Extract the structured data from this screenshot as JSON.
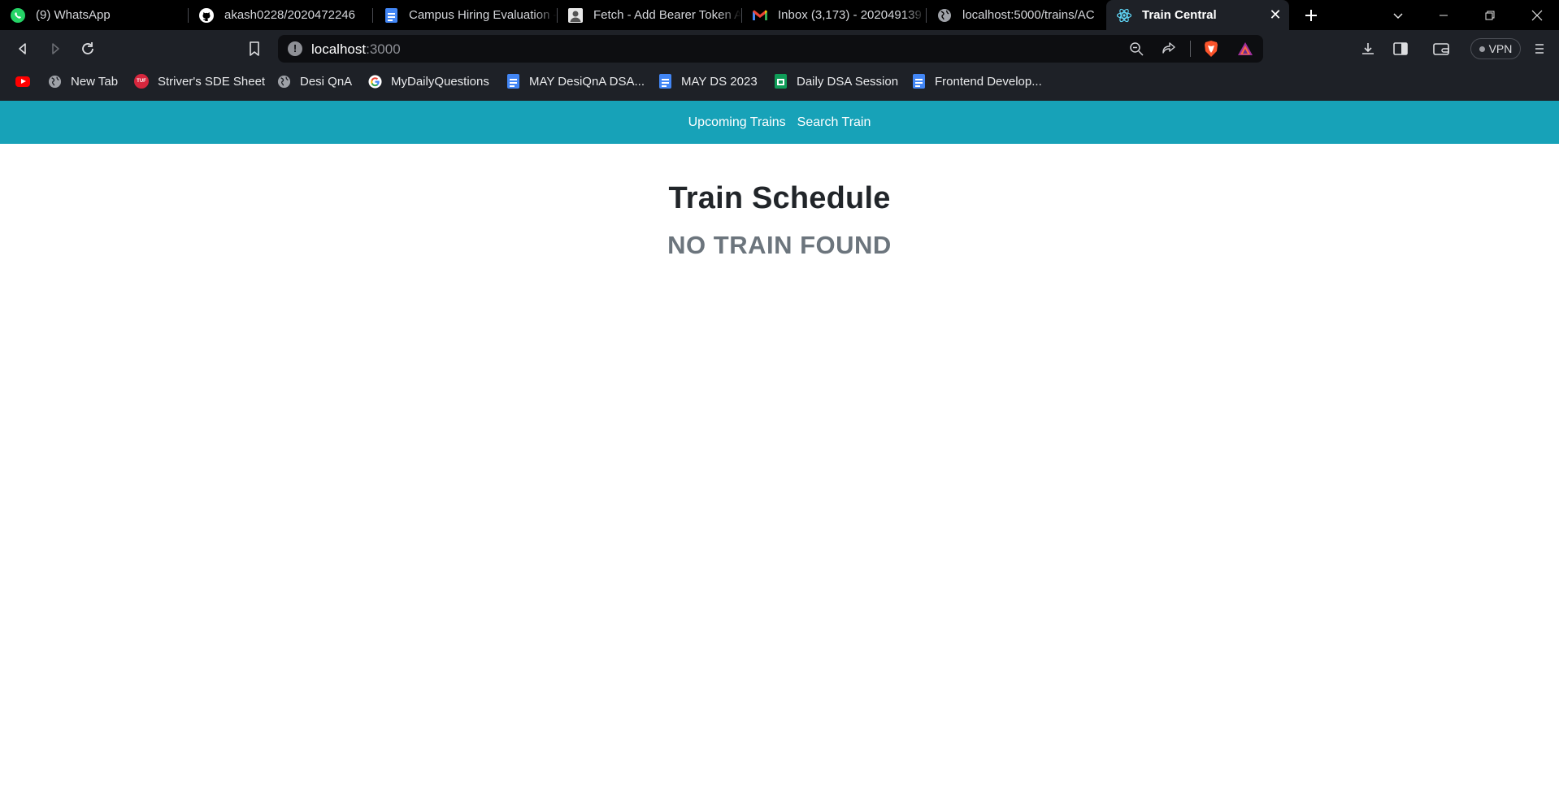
{
  "browser": {
    "tabs": [
      {
        "title": "(9) WhatsApp",
        "icon": "whatsapp-icon",
        "active": false
      },
      {
        "title": "akash0228/2020472246",
        "icon": "github-icon",
        "active": false
      },
      {
        "title": "Campus Hiring Evaluation -",
        "icon": "google-docs-icon",
        "active": false
      },
      {
        "title": "Fetch - Add Bearer Token A",
        "icon": "avatar-favicon-icon",
        "active": false
      },
      {
        "title": "Inbox (3,173) - 202049139",
        "icon": "gmail-icon",
        "active": false
      },
      {
        "title": "localhost:5000/trains/AC",
        "icon": "globe-icon",
        "active": false
      },
      {
        "title": "Train Central",
        "icon": "react-icon",
        "active": true
      }
    ],
    "address": {
      "host": "localhost",
      "port": ":3000"
    },
    "vpn_label": "VPN",
    "bookmarks": [
      {
        "label": "",
        "icon": "youtube-icon"
      },
      {
        "label": "New Tab",
        "icon": "globe-icon"
      },
      {
        "label": "Striver's SDE Sheet",
        "icon": "tuf-icon"
      },
      {
        "label": "Desi QnA",
        "icon": "globe-icon"
      },
      {
        "label": "MyDailyQuestions",
        "icon": "google-icon"
      },
      {
        "label": "MAY DesiQnA DSA...",
        "icon": "google-docs-icon"
      },
      {
        "label": "MAY DS 2023",
        "icon": "google-docs-icon"
      },
      {
        "label": "Daily DSA Session",
        "icon": "google-sheets-icon"
      },
      {
        "label": "Frontend Develop...",
        "icon": "google-docs-icon"
      }
    ]
  },
  "app": {
    "nav": {
      "upcoming": "Upcoming Trains",
      "search": "Search Train"
    },
    "title": "Train Schedule",
    "empty_message": "NO TRAIN FOUND"
  },
  "colors": {
    "nav_bg": "#17a2b8",
    "tab_bg": "#000000",
    "toolbar_bg": "#1e2127",
    "title_text": "#212529",
    "muted_text": "#6c757d"
  }
}
